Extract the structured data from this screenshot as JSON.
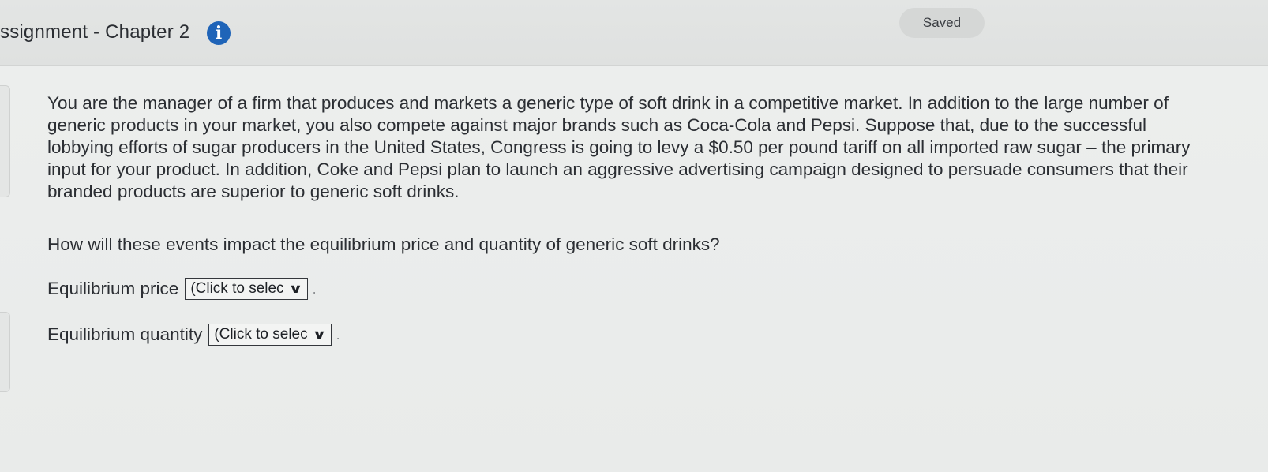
{
  "header": {
    "title": "ssignment - Chapter 2",
    "info_icon": "info-icon",
    "status": "Saved"
  },
  "question": {
    "body": "You are the manager of a firm that produces and markets a generic type of soft drink in a competitive market. In addition to the large number of generic products in your market, you also compete against major brands such as Coca-Cola and Pepsi. Suppose that, due to the successful lobbying efforts of sugar producers in the United States, Congress is going to levy a $0.50 per pound tariff on all imported raw sugar – the primary input for your product. In addition, Coke and Pepsi plan to launch an aggressive advertising campaign designed to persuade consumers that their branded products are superior to generic soft drinks.",
    "prompt": "How will these events impact the equilibrium price and quantity of generic soft drinks?"
  },
  "answers": [
    {
      "label": "Equilibrium price",
      "selected": "(Click to selec",
      "icon": "chevron-down-icon"
    },
    {
      "label": "Equilibrium quantity",
      "selected": "(Click to selec",
      "icon": "chevron-down-icon"
    }
  ],
  "colors": {
    "accent": "#1f64b8",
    "background": "#e6e8e7",
    "text": "#2b2e33"
  }
}
